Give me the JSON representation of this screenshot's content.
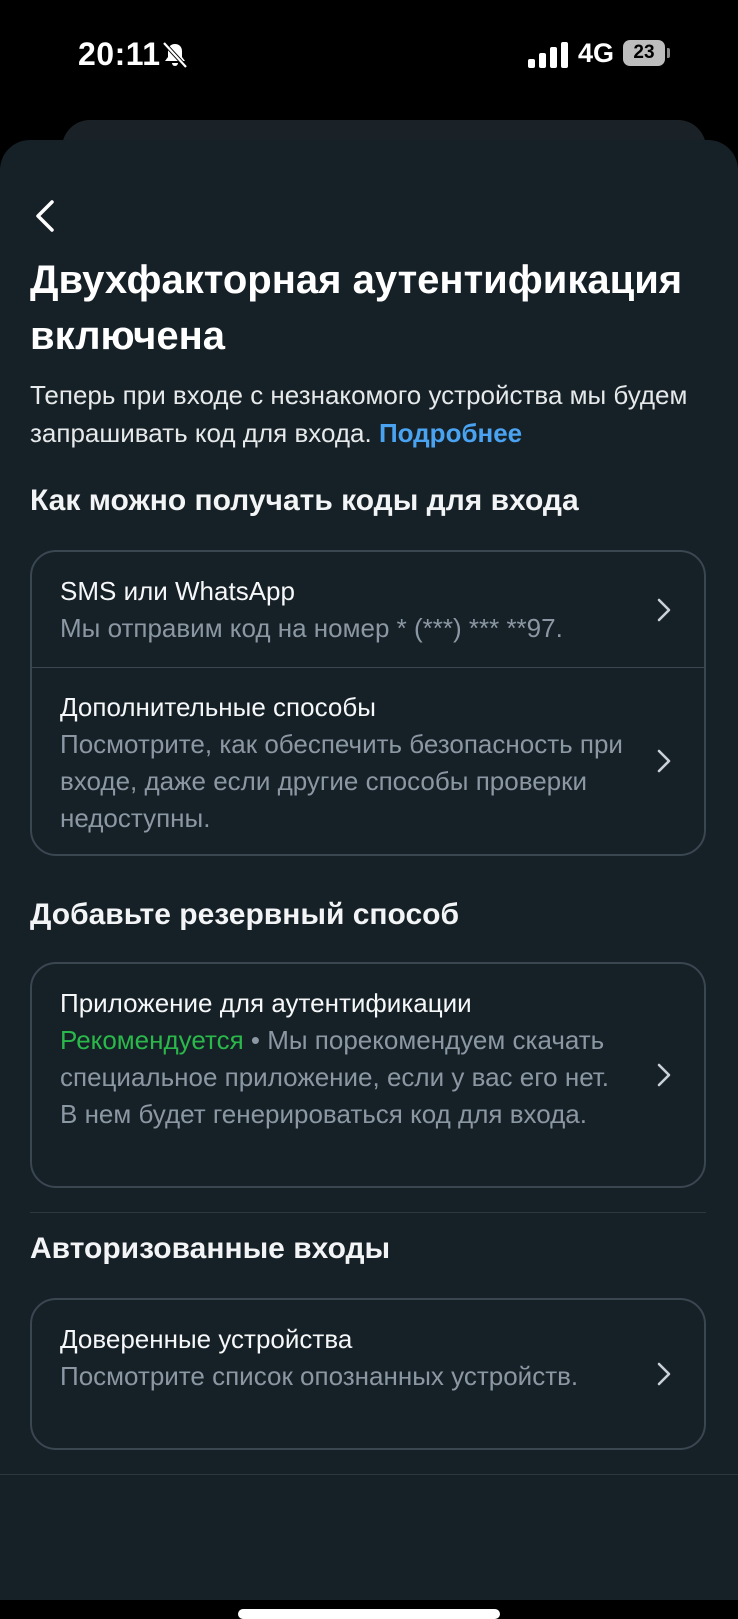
{
  "status": {
    "time": "20:11",
    "network": "4G",
    "battery": "23"
  },
  "title": "Двухфакторная аутентификация включена",
  "description": {
    "text": "Теперь при входе с незнакомого устройства мы будем запрашивать код для входа.",
    "link": "Подробнее"
  },
  "sections": {
    "receive_codes": {
      "heading": "Как можно получать коды для входа",
      "items": [
        {
          "title": "SMS или WhatsApp",
          "subtitle": "Мы отправим код на номер * (***) *** **97."
        },
        {
          "title": "Дополнительные способы",
          "subtitle": "Посмотрите, как обеспечить безопасность при входе, даже если другие способы проверки недоступны."
        }
      ]
    },
    "backup": {
      "heading": "Добавьте резервный способ",
      "items": [
        {
          "title": "Приложение для аутентификации",
          "badge": "Рекомендуется",
          "subtitle": " • Мы порекомендуем скачать специальное приложение, если у вас его нет. В нем будет генерироваться код для входа."
        }
      ]
    },
    "authorized": {
      "heading": "Авторизованные входы",
      "items": [
        {
          "title": "Доверенные устройства",
          "subtitle": "Посмотрите список опознанных устройств."
        }
      ]
    }
  },
  "colors": {
    "background": "#162027",
    "link": "#4aa3f0",
    "recommended": "#2bb84a",
    "muted_text": "#8b98a3"
  },
  "icons": [
    "bell-slash-icon",
    "signal-icon",
    "battery-icon",
    "back-arrow-icon",
    "chevron-right-icon"
  ]
}
